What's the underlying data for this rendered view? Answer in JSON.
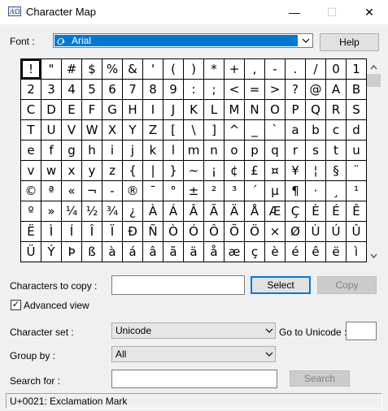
{
  "window": {
    "title": "Character Map",
    "min_glyph": "—",
    "max_glyph": "☐",
    "close_glyph": "✕"
  },
  "font": {
    "label": "Font :",
    "value": "Arial",
    "help_button": "Help"
  },
  "characters": [
    [
      "!",
      "\"",
      "#",
      "$",
      "%",
      "&",
      "'",
      "(",
      ")",
      "*",
      "+",
      ",",
      "-",
      ".",
      "/",
      "0",
      "1"
    ],
    [
      "2",
      "3",
      "4",
      "5",
      "6",
      "7",
      "8",
      "9",
      ":",
      ";",
      "<",
      "=",
      ">",
      "?",
      "@",
      "A",
      "B"
    ],
    [
      "C",
      "D",
      "E",
      "F",
      "G",
      "H",
      "I",
      "J",
      "K",
      "L",
      "M",
      "N",
      "O",
      "P",
      "Q",
      "R",
      "S"
    ],
    [
      "T",
      "U",
      "V",
      "W",
      "X",
      "Y",
      "Z",
      "[",
      "\\",
      "]",
      "^",
      "_",
      "`",
      "a",
      "b",
      "c",
      "d"
    ],
    [
      "e",
      "f",
      "g",
      "h",
      "i",
      "j",
      "k",
      "l",
      "m",
      "n",
      "o",
      "p",
      "q",
      "r",
      "s",
      "t",
      "u"
    ],
    [
      "v",
      "w",
      "x",
      "y",
      "z",
      "{",
      "|",
      "}",
      "~",
      "¡",
      "¢",
      "£",
      "¤",
      "¥",
      "¦",
      "§",
      "¨"
    ],
    [
      "©",
      "ª",
      "«",
      "¬",
      "-",
      "®",
      "¯",
      "°",
      "±",
      "²",
      "³",
      "´",
      "µ",
      "¶",
      "·",
      "¸",
      "¹"
    ],
    [
      "º",
      "»",
      "¼",
      "½",
      "¾",
      "¿",
      "À",
      "Á",
      "Â",
      "Ã",
      "Ä",
      "Å",
      "Æ",
      "Ç",
      "È",
      "É",
      "Ê"
    ],
    [
      "Ë",
      "Ì",
      "Í",
      "Î",
      "Ï",
      "Ð",
      "Ñ",
      "Ò",
      "Ó",
      "Ô",
      "Õ",
      "Ö",
      "×",
      "Ø",
      "Ù",
      "Ú",
      "Û"
    ],
    [
      "Ü",
      "Ý",
      "Þ",
      "ß",
      "à",
      "á",
      "â",
      "ã",
      "ä",
      "å",
      "æ",
      "ç",
      "è",
      "é",
      "ê",
      "ë",
      "ì"
    ]
  ],
  "copy": {
    "label": "Characters to copy :",
    "value": "",
    "select_button": "Select",
    "copy_button": "Copy"
  },
  "advanced": {
    "label": "Advanced view",
    "checked_glyph": "✓"
  },
  "charset": {
    "label": "Character set :",
    "value": "Unicode",
    "goto_label": "Go to Unicode :",
    "goto_value": ""
  },
  "groupby": {
    "label": "Group by :",
    "value": "All"
  },
  "search": {
    "label": "Search for :",
    "value": "",
    "button": "Search"
  },
  "status": {
    "text": "U+0021: Exclamation Mark"
  }
}
